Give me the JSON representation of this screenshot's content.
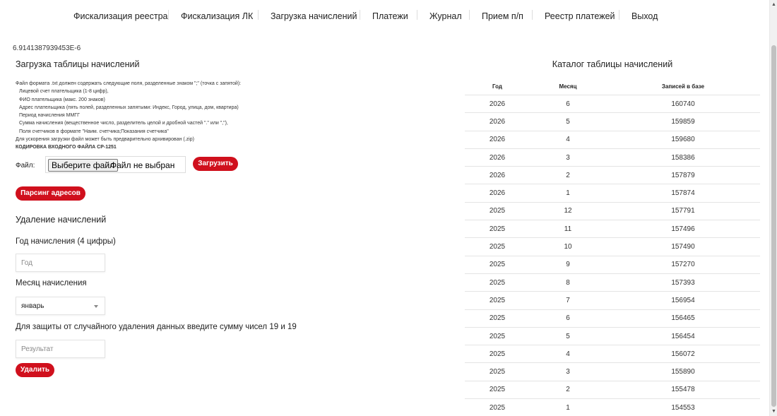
{
  "nav": [
    "Фискализация реестра",
    "Фискализация ЛК",
    "Загрузка начислений",
    "Платежи",
    "Журнал",
    "Прием п/п",
    "Реестр платежей",
    "Выход"
  ],
  "debug_value": "6.9141387939453E-6",
  "upload": {
    "title": "Загрузка таблицы начислений",
    "desc": [
      "Файл формата .txt должен содержать следующие поля, разделенные знаком \";\" (точка с запятой):",
      "Лицевой счет плательщика (1-8 цифр),",
      "ФИО плательщика (макс. 200 знаков)",
      "Адрес плательщика (пять полей, разделенных запятыми: Индекс, Город, улица, дом, квартира)",
      "Период начисления ММГГ",
      "Сумма начисления (вещественное число, разделитель целой и дробной частей \".\" или \",\"),",
      "Поля счетчиков в формате \"Наим. счетчика;Показания счетчика\"",
      "Для ускорения загрузки файл может быть предварительно архивирован (.zip)",
      "КОДИРОВКА ВХОДНОГО ФАЙЛА CP-1251"
    ],
    "file_label": "Файл:",
    "file_button": "Выберите файл",
    "file_none": "Файл не выбран",
    "upload_button": "Загрузить",
    "parse_button": "Парсинг адресов"
  },
  "delete": {
    "title": "Удаление начислений",
    "year_label": "Год начисления (4 цифры)",
    "year_placeholder": "Год",
    "month_label": "Месяц начисления",
    "month_value": "январь",
    "protect_label": "Для защиты от случайного удаления данных введите сумму чисел 19 и 19",
    "result_placeholder": "Результат",
    "delete_button": "Удалить"
  },
  "catalog": {
    "title": "Каталог таблицы начислений",
    "headers": [
      "Год",
      "Месяц",
      "Записей в базе"
    ],
    "rows": [
      [
        "2026",
        "6",
        "160740"
      ],
      [
        "2026",
        "5",
        "159859"
      ],
      [
        "2026",
        "4",
        "159680"
      ],
      [
        "2026",
        "3",
        "158386"
      ],
      [
        "2026",
        "2",
        "157879"
      ],
      [
        "2026",
        "1",
        "157874"
      ],
      [
        "2025",
        "12",
        "157791"
      ],
      [
        "2025",
        "11",
        "157496"
      ],
      [
        "2025",
        "10",
        "157490"
      ],
      [
        "2025",
        "9",
        "157270"
      ],
      [
        "2025",
        "8",
        "157393"
      ],
      [
        "2025",
        "7",
        "156954"
      ],
      [
        "2025",
        "6",
        "156465"
      ],
      [
        "2025",
        "5",
        "156454"
      ],
      [
        "2025",
        "4",
        "156072"
      ],
      [
        "2025",
        "3",
        "155890"
      ],
      [
        "2025",
        "2",
        "155478"
      ],
      [
        "2025",
        "1",
        "154553"
      ]
    ]
  },
  "colors": {
    "accent": "#d0101d"
  }
}
